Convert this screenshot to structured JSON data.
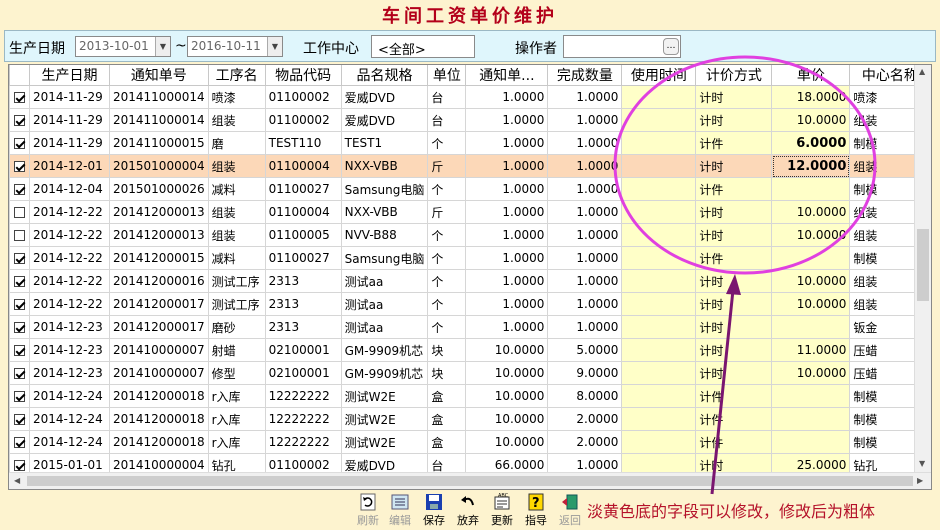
{
  "window_title": "车间工资单价维护",
  "filter": {
    "date_label": "生产日期",
    "date_from": "2013-10-01",
    "date_sep": "~",
    "date_to": "2016-10-11",
    "center_label": "工作中心",
    "center_value": "<全部>",
    "operator_label": "操作者",
    "operator_value": ""
  },
  "columns": [
    "",
    "生产日期",
    "通知单号",
    "工序名",
    "物品代码",
    "品名规格",
    "单位",
    "通知单...",
    "完成数量",
    "使用时间",
    "计价方式",
    "单价",
    "中心名称"
  ],
  "rows": [
    {
      "checked": true,
      "date": "2014-11-29",
      "order": "201411000014",
      "process": "喷漆",
      "code": "01100002",
      "name": "爱威DVD",
      "unit": "台",
      "notice_qty": "1.0000",
      "done_qty": "1.0000",
      "use_time": "",
      "pricing": "计时",
      "price": "18.0000",
      "center": "喷漆"
    },
    {
      "checked": true,
      "date": "2014-11-29",
      "order": "201411000014",
      "process": "组装",
      "code": "01100002",
      "name": "爱威DVD",
      "unit": "台",
      "notice_qty": "1.0000",
      "done_qty": "1.0000",
      "use_time": "",
      "pricing": "计时",
      "price": "10.0000",
      "center": "组装"
    },
    {
      "checked": true,
      "date": "2014-11-29",
      "order": "201411000015",
      "process": "磨",
      "code": "TEST110",
      "name": "TEST1",
      "unit": "个",
      "notice_qty": "1.0000",
      "done_qty": "1.0000",
      "use_time": "",
      "pricing": "计件",
      "price": "6.0000",
      "center": "制模",
      "bold": true
    },
    {
      "checked": true,
      "date": "2014-12-01",
      "order": "201501000004",
      "process": "组装",
      "code": "01100004",
      "name": "NXX-VBB",
      "unit": "斤",
      "notice_qty": "1.0000",
      "done_qty": "1.0000",
      "use_time": "",
      "pricing": "计时",
      "price": "12.0000",
      "center": "组装",
      "bold": true,
      "selected": true
    },
    {
      "checked": true,
      "date": "2014-12-04",
      "order": "201501000026",
      "process": "减料",
      "code": "01100027",
      "name": "Samsung电脑",
      "unit": "个",
      "notice_qty": "1.0000",
      "done_qty": "1.0000",
      "use_time": "",
      "pricing": "计件",
      "price": "",
      "center": "制模"
    },
    {
      "checked": false,
      "date": "2014-12-22",
      "order": "201412000013",
      "process": "组装",
      "code": "01100004",
      "name": "NXX-VBB",
      "unit": "斤",
      "notice_qty": "1.0000",
      "done_qty": "1.0000",
      "use_time": "",
      "pricing": "计时",
      "price": "10.0000",
      "center": "组装"
    },
    {
      "checked": false,
      "date": "2014-12-22",
      "order": "201412000013",
      "process": "组装",
      "code": "01100005",
      "name": "NVV-B88",
      "unit": "个",
      "notice_qty": "1.0000",
      "done_qty": "1.0000",
      "use_time": "",
      "pricing": "计时",
      "price": "10.0000",
      "center": "组装"
    },
    {
      "checked": true,
      "date": "2014-12-22",
      "order": "201412000015",
      "process": "减料",
      "code": "01100027",
      "name": "Samsung电脑",
      "unit": "个",
      "notice_qty": "1.0000",
      "done_qty": "1.0000",
      "use_time": "",
      "pricing": "计件",
      "price": "",
      "center": "制模"
    },
    {
      "checked": true,
      "date": "2014-12-22",
      "order": "201412000016",
      "process": "测试工序",
      "code": "2313",
      "name": "测试aa",
      "unit": "个",
      "notice_qty": "1.0000",
      "done_qty": "1.0000",
      "use_time": "",
      "pricing": "计时",
      "price": "10.0000",
      "center": "组装"
    },
    {
      "checked": true,
      "date": "2014-12-22",
      "order": "201412000017",
      "process": "测试工序",
      "code": "2313",
      "name": "测试aa",
      "unit": "个",
      "notice_qty": "1.0000",
      "done_qty": "1.0000",
      "use_time": "",
      "pricing": "计时",
      "price": "10.0000",
      "center": "组装"
    },
    {
      "checked": true,
      "date": "2014-12-23",
      "order": "201412000017",
      "process": "磨砂",
      "code": "2313",
      "name": "测试aa",
      "unit": "个",
      "notice_qty": "1.0000",
      "done_qty": "1.0000",
      "use_time": "",
      "pricing": "计时",
      "price": "",
      "center": "钣金"
    },
    {
      "checked": true,
      "date": "2014-12-23",
      "order": "201410000007",
      "process": "射蜡",
      "code": "02100001",
      "name": "GM-9909机芯",
      "unit": "块",
      "notice_qty": "10.0000",
      "done_qty": "5.0000",
      "use_time": "",
      "pricing": "计时",
      "price": "11.0000",
      "center": "压蜡"
    },
    {
      "checked": true,
      "date": "2014-12-23",
      "order": "201410000007",
      "process": "修型",
      "code": "02100001",
      "name": "GM-9909机芯",
      "unit": "块",
      "notice_qty": "10.0000",
      "done_qty": "9.0000",
      "use_time": "",
      "pricing": "计时",
      "price": "10.0000",
      "center": "压蜡"
    },
    {
      "checked": true,
      "date": "2014-12-24",
      "order": "201412000018",
      "process": "r入库",
      "code": "12222222",
      "name": "测试W2E",
      "unit": "盒",
      "notice_qty": "10.0000",
      "done_qty": "8.0000",
      "use_time": "",
      "pricing": "计件",
      "price": "",
      "center": "制模"
    },
    {
      "checked": true,
      "date": "2014-12-24",
      "order": "201412000018",
      "process": "r入库",
      "code": "12222222",
      "name": "测试W2E",
      "unit": "盒",
      "notice_qty": "10.0000",
      "done_qty": "2.0000",
      "use_time": "",
      "pricing": "计件",
      "price": "",
      "center": "制模"
    },
    {
      "checked": true,
      "date": "2014-12-24",
      "order": "201412000018",
      "process": "r入库",
      "code": "12222222",
      "name": "测试W2E",
      "unit": "盒",
      "notice_qty": "10.0000",
      "done_qty": "2.0000",
      "use_time": "",
      "pricing": "计件",
      "price": "",
      "center": "制模"
    },
    {
      "checked": true,
      "date": "2015-01-01",
      "order": "201410000004",
      "process": "钻孔",
      "code": "01100002",
      "name": "爱威DVD",
      "unit": "台",
      "notice_qty": "66.0000",
      "done_qty": "1.0000",
      "use_time": "",
      "pricing": "计时",
      "price": "25.0000",
      "center": "钻孔"
    }
  ],
  "toolbar": [
    {
      "label": "刷新",
      "icon": "refresh-icon",
      "enabled": false
    },
    {
      "label": "编辑",
      "icon": "edit-icon",
      "enabled": false
    },
    {
      "label": "保存",
      "icon": "save-icon",
      "enabled": true
    },
    {
      "label": "放弃",
      "icon": "undo-icon",
      "enabled": true
    },
    {
      "label": "更新",
      "icon": "update-icon",
      "enabled": true
    },
    {
      "label": "指导",
      "icon": "help-icon",
      "enabled": true
    },
    {
      "label": "返回",
      "icon": "exit-icon",
      "enabled": false
    }
  ],
  "annotation_note": "淡黄色底的字段可以修改，修改后为粗体",
  "colors": {
    "editable_bg": "#ffffc8",
    "selected_row": "#fcd8b8",
    "annotation": "#e040e0",
    "arrow": "#7a1670",
    "title": "#b3001a"
  }
}
